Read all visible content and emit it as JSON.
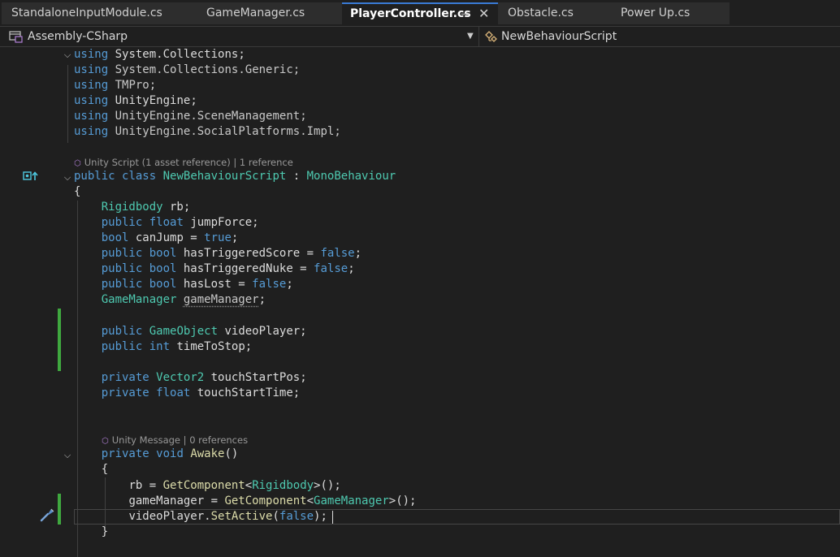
{
  "tabs": [
    {
      "label": "StandaloneInputModule.cs"
    },
    {
      "label": "GameManager.cs"
    },
    {
      "label": "PlayerController.cs",
      "pin_icon": "⊸",
      "close_icon": "✕"
    },
    {
      "label": "Obstacle.cs"
    },
    {
      "label": "Power Up.cs"
    }
  ],
  "navbar": {
    "project": "Assembly-CSharp",
    "type": "NewBehaviourScript",
    "caret": "▼"
  },
  "fold_glyph": "⌵",
  "codelens": {
    "class": {
      "icon": "⬡",
      "text": "Unity Script (1 asset reference) | 1 reference"
    },
    "awake": {
      "icon": "⬡",
      "text": "Unity Message | 0 references"
    }
  },
  "code": {
    "l1": [
      "using",
      " ",
      "System",
      ".",
      "Collections",
      ";"
    ],
    "l2": [
      "using",
      " ",
      "System",
      ".",
      "Collections",
      ".",
      "Generic",
      ";"
    ],
    "l3": [
      "using",
      " ",
      "TMPro",
      ";"
    ],
    "l4": [
      "using",
      " ",
      "UnityEngine",
      ";"
    ],
    "l5": [
      "using",
      " ",
      "UnityEngine",
      ".",
      "SceneManagement",
      ";"
    ],
    "l6": [
      "using",
      " ",
      "UnityEngine",
      ".",
      "SocialPlatforms",
      ".",
      "Impl",
      ";"
    ],
    "l8": [
      "public",
      " ",
      "class",
      " ",
      "NewBehaviourScript",
      " : ",
      "MonoBehaviour"
    ],
    "l9": [
      "{"
    ],
    "l10": [
      "    ",
      "Rigidbody",
      " rb;"
    ],
    "l11": [
      "    ",
      "public",
      " ",
      "float",
      " jumpForce;"
    ],
    "l12": [
      "    ",
      "bool",
      " canJump = ",
      "true",
      ";"
    ],
    "l13": [
      "    ",
      "public",
      " ",
      "bool",
      " hasTriggeredScore = ",
      "false",
      ";"
    ],
    "l14": [
      "    ",
      "public",
      " ",
      "bool",
      " hasTriggeredNuke = ",
      "false",
      ";"
    ],
    "l15": [
      "    ",
      "public",
      " ",
      "bool",
      " hasLost = ",
      "false",
      ";"
    ],
    "l16": [
      "    ",
      "GameManager",
      " ",
      "gameManager",
      ";"
    ],
    "l18": [
      "    ",
      "public",
      " ",
      "GameObject",
      " videoPlayer;"
    ],
    "l19": [
      "    ",
      "public",
      " ",
      "int",
      " timeToStop;"
    ],
    "l21": [
      "    ",
      "private",
      " ",
      "Vector2",
      " touchStartPos;"
    ],
    "l22": [
      "    ",
      "private",
      " ",
      "float",
      " touchStartTime;"
    ],
    "l25": [
      "    ",
      "private",
      " ",
      "void",
      " ",
      "Awake",
      "()"
    ],
    "l26": [
      "    ",
      "{"
    ],
    "l27": [
      "        ",
      "rb = ",
      "GetComponent",
      "<",
      "Rigidbody",
      ">();"
    ],
    "l28": [
      "        ",
      "gameManager = ",
      "GetComponent",
      "<",
      "GameManager",
      ">();"
    ],
    "l29": [
      "        ",
      "videoPlayer",
      ".",
      "SetActive",
      "(",
      "false",
      ");"
    ],
    "l30": [
      "    ",
      "}"
    ]
  },
  "colors": {
    "keyword": "#569cd6",
    "type": "#4ec9b0",
    "method": "#dcdcaa",
    "text": "#dcdcdc",
    "change_bar": "#3fa83f",
    "active_tab_accent": "#3a7bd5"
  },
  "icons": {
    "project": "csharp-project-icon",
    "type": "class-type-icon",
    "class_glyph": "unity-script-glyph",
    "screwdriver": "quick-actions-screwdriver-icon"
  }
}
